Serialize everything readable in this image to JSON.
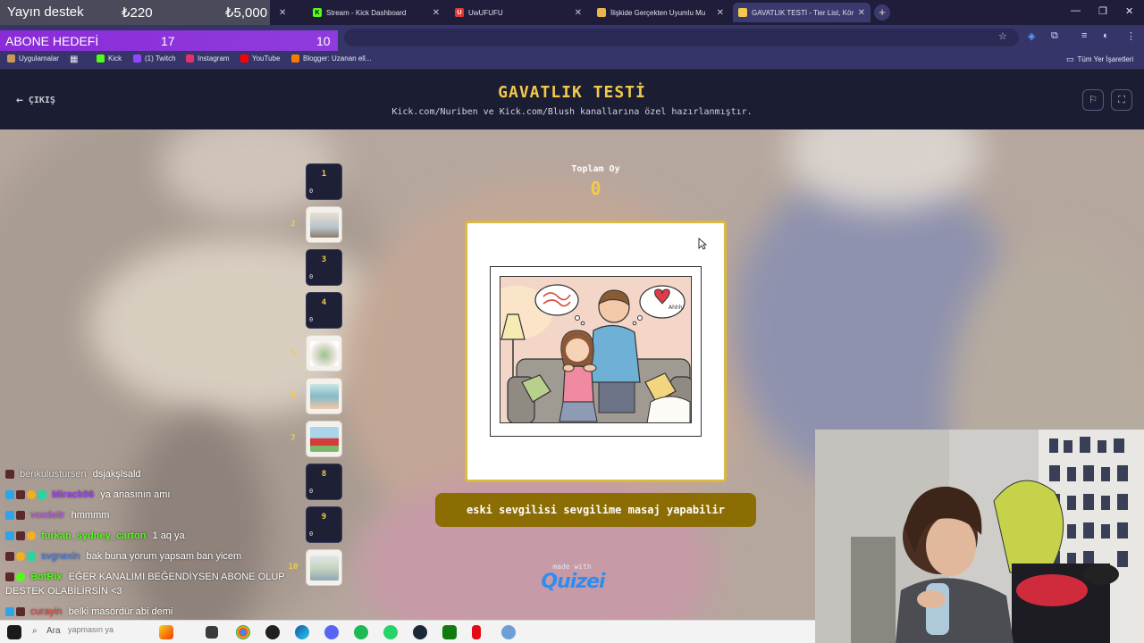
{
  "overlay": {
    "support_label": "Yayın destek",
    "support_current": "₺220",
    "support_goal": "₺5,000",
    "sub_goal_label": "ABONE HEDEFİ",
    "sub_current": "17",
    "sub_target": "10"
  },
  "browser": {
    "tabs": [
      {
        "title": "Stream - Kick Dashboard",
        "favicon": "kick-icon"
      },
      {
        "title": "UwUFUFU",
        "favicon": "uwufufu-icon"
      },
      {
        "title": "İlişkide Gerçekten Uyumlu Mu",
        "favicon": "page-icon"
      },
      {
        "title": "GAVATLIK TESTİ - Tier List, Kör",
        "favicon": "quizei-icon"
      }
    ],
    "bookmarks": [
      {
        "label": "Uygulamalar",
        "icon": "apps-grid-icon"
      },
      {
        "label": "Kick",
        "icon": "kick-icon"
      },
      {
        "label": "(1) Twitch",
        "icon": "twitch-icon"
      },
      {
        "label": "Instagram",
        "icon": "instagram-icon"
      },
      {
        "label": "YouTube",
        "icon": "youtube-icon"
      },
      {
        "label": "Blogger: Uzanan ell...",
        "icon": "blogger-icon"
      },
      {
        "label": "Tüm Yer İşaretleri",
        "icon": "folder-icon"
      }
    ]
  },
  "quiz": {
    "exit_label": "ÇIKIŞ",
    "title": "GAVATLIK TESTİ",
    "subtitle": "Kick.com/Nuriben ve Kick.com/Blush kanallarına özel hazırlanmıştır.",
    "score_label": "Toplam Oy",
    "score_value": "0",
    "caption": "eski sevgilisi sevgilime masaj yapabilir",
    "made_with": "made with",
    "brand": "Quizei",
    "speech_text": "Ahhh!"
  },
  "tiers": [
    {
      "number": "1",
      "count": "0",
      "has_image": false
    },
    {
      "number": "2",
      "count": "",
      "has_image": true
    },
    {
      "number": "3",
      "count": "0",
      "has_image": false
    },
    {
      "number": "4",
      "count": "0",
      "has_image": false
    },
    {
      "number": "5",
      "count": "",
      "has_image": true
    },
    {
      "number": "6",
      "count": "",
      "has_image": true
    },
    {
      "number": "7",
      "count": "",
      "has_image": true
    },
    {
      "number": "8",
      "count": "0",
      "has_image": false
    },
    {
      "number": "9",
      "count": "0",
      "has_image": false
    },
    {
      "number": "10",
      "count": "",
      "has_image": true
    }
  ],
  "chat": [
    {
      "user": "benkulustursen",
      "message": "dsjakşlsald",
      "color": "#e0e0e0"
    },
    {
      "user": "Mirack06",
      "message": "ya anasının amı",
      "color": "#a040ff"
    },
    {
      "user": "voxdeitr",
      "message": "hmmmm",
      "color": "#c64bff"
    },
    {
      "user": "furkan_sydney_carton",
      "message": "1 aq ya",
      "color": "#53fc18"
    },
    {
      "user": "svgnexin",
      "message": "bak buna yorum yapsam ban yicem",
      "color": "#3b82f6"
    },
    {
      "user": "BotRix",
      "message": "EĞER KANALIMI BEĞENDİYSEN ABONE OLUP",
      "message2": "DESTEK OLABİLİRSİN <3",
      "color": "#53fc18"
    },
    {
      "user": "curayin",
      "message": "belki masördür abi demi",
      "color": "#ff3b3b"
    },
    {
      "user": "",
      "message": "yapmasın ya",
      "color": "#9a9aa8"
    }
  ],
  "taskbar": {
    "search_placeholder": "Ara"
  },
  "colors": {
    "accent_gold": "#f2c94c",
    "card_border": "#d9b93f",
    "caption_bg": "#8c6d04",
    "header_bg": "#1b1e33"
  }
}
